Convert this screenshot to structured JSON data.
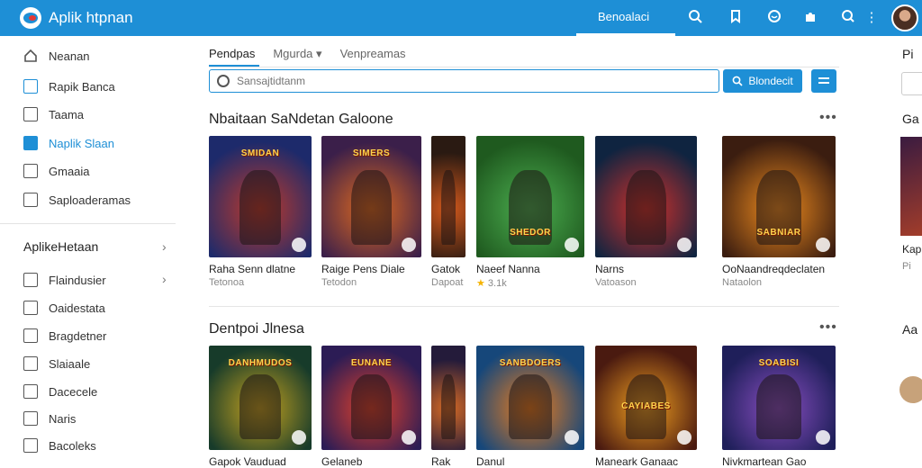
{
  "header": {
    "app_title": "Aplik htpnan",
    "nav_link": "Benoalaci",
    "icons": [
      "search-icon",
      "bookmark-icon",
      "chat-icon",
      "puzzle-icon",
      "search-alt-icon",
      "more-vert-icon"
    ]
  },
  "sidebar": {
    "items": [
      {
        "label": "Neanan",
        "icon": "home-icon"
      },
      {
        "label": "Rapik Banca",
        "icon": "tag-icon"
      },
      {
        "label": "Taama",
        "icon": "building-icon"
      },
      {
        "label": "Naplik Slaan",
        "icon": "apps-icon",
        "active": true
      },
      {
        "label": "Gmaaia",
        "icon": "square-icon"
      },
      {
        "label": "Saploaderamas",
        "icon": "grid-icon"
      }
    ],
    "section_header": "AplikeHetaan",
    "section_items": [
      {
        "label": "Flaindusier",
        "icon": "square-icon"
      },
      {
        "label": "Oaidestata",
        "icon": "tag-icon"
      },
      {
        "label": "Bragdetner",
        "icon": "square-icon"
      },
      {
        "label": "Slaiaale",
        "icon": "check-icon"
      },
      {
        "label": "Dacecele",
        "icon": "folder-icon"
      },
      {
        "label": "Naris",
        "icon": "tag-icon"
      },
      {
        "label": "Bacoleks",
        "icon": "edit-icon"
      }
    ]
  },
  "tabs": [
    {
      "label": "Pendpas",
      "active": true
    },
    {
      "label": "Mgurda",
      "dropdown": true
    },
    {
      "label": "Venpreamas"
    }
  ],
  "search": {
    "placeholder": "Sansajtidtanm",
    "button_label": "Blondecit"
  },
  "sections": [
    {
      "title": "Nbaitaan SaNdetan Galoone",
      "cards": [
        {
          "title": "Raha Senn dlatne",
          "sub": "Tetonoa",
          "banner": "SMIDAN",
          "colors": [
            "#1d2a6b",
            "#c03a2a"
          ]
        },
        {
          "title": "Raige Pens Diale",
          "sub": "Tetodon",
          "banner": "SIMERS",
          "colors": [
            "#3b1f4a",
            "#e06a1e"
          ]
        },
        {
          "title": "Gatok",
          "sub": "Dapoat",
          "banner": "",
          "colors": [
            "#2a1a12",
            "#d4591c"
          ]
        },
        {
          "title": "Naeef Nanna",
          "sub": "3.1k",
          "rating": "★",
          "banner": "SHEDOR",
          "colors": [
            "#1f5a1f",
            "#4caf50"
          ]
        },
        {
          "title": "Narns",
          "sub": "Vatoason",
          "banner": "",
          "colors": [
            "#0f2440",
            "#d1302a"
          ]
        },
        {
          "title": "OoNaandreqdeclaten",
          "sub": "Nataolon",
          "banner": "SABNIAR",
          "colors": [
            "#3b1d10",
            "#f08c1e"
          ]
        }
      ]
    },
    {
      "title": "Dentpoi Jlnesa",
      "cards": [
        {
          "title": "Gapok Vauduad",
          "sub": "",
          "banner": "DANHMUDOS",
          "colors": [
            "#173b2a",
            "#c7a31f"
          ]
        },
        {
          "title": "Gelaneb",
          "sub": "",
          "banner": "EUNANE",
          "colors": [
            "#2c1c55",
            "#e2412a"
          ]
        },
        {
          "title": "Rak",
          "sub": "",
          "banner": "",
          "colors": [
            "#241b3a",
            "#d86b24"
          ]
        },
        {
          "title": "Danul",
          "sub": "",
          "banner": "SANBDOERS",
          "colors": [
            "#16477a",
            "#ef7d1b"
          ]
        },
        {
          "title": "Maneark Ganaac",
          "sub": "",
          "banner": "CAYIABES",
          "colors": [
            "#4a1a10",
            "#f2a020"
          ]
        },
        {
          "title": "Nivkmartean Gao",
          "sub": "",
          "banner": "SOABISI",
          "colors": [
            "#1f1f5a",
            "#8a4fc2"
          ]
        }
      ]
    }
  ],
  "right_column": {
    "label1": "Pi",
    "label2": "Ga",
    "card_title": "Kap",
    "card_sub": "Pi",
    "label3": "Aa"
  }
}
